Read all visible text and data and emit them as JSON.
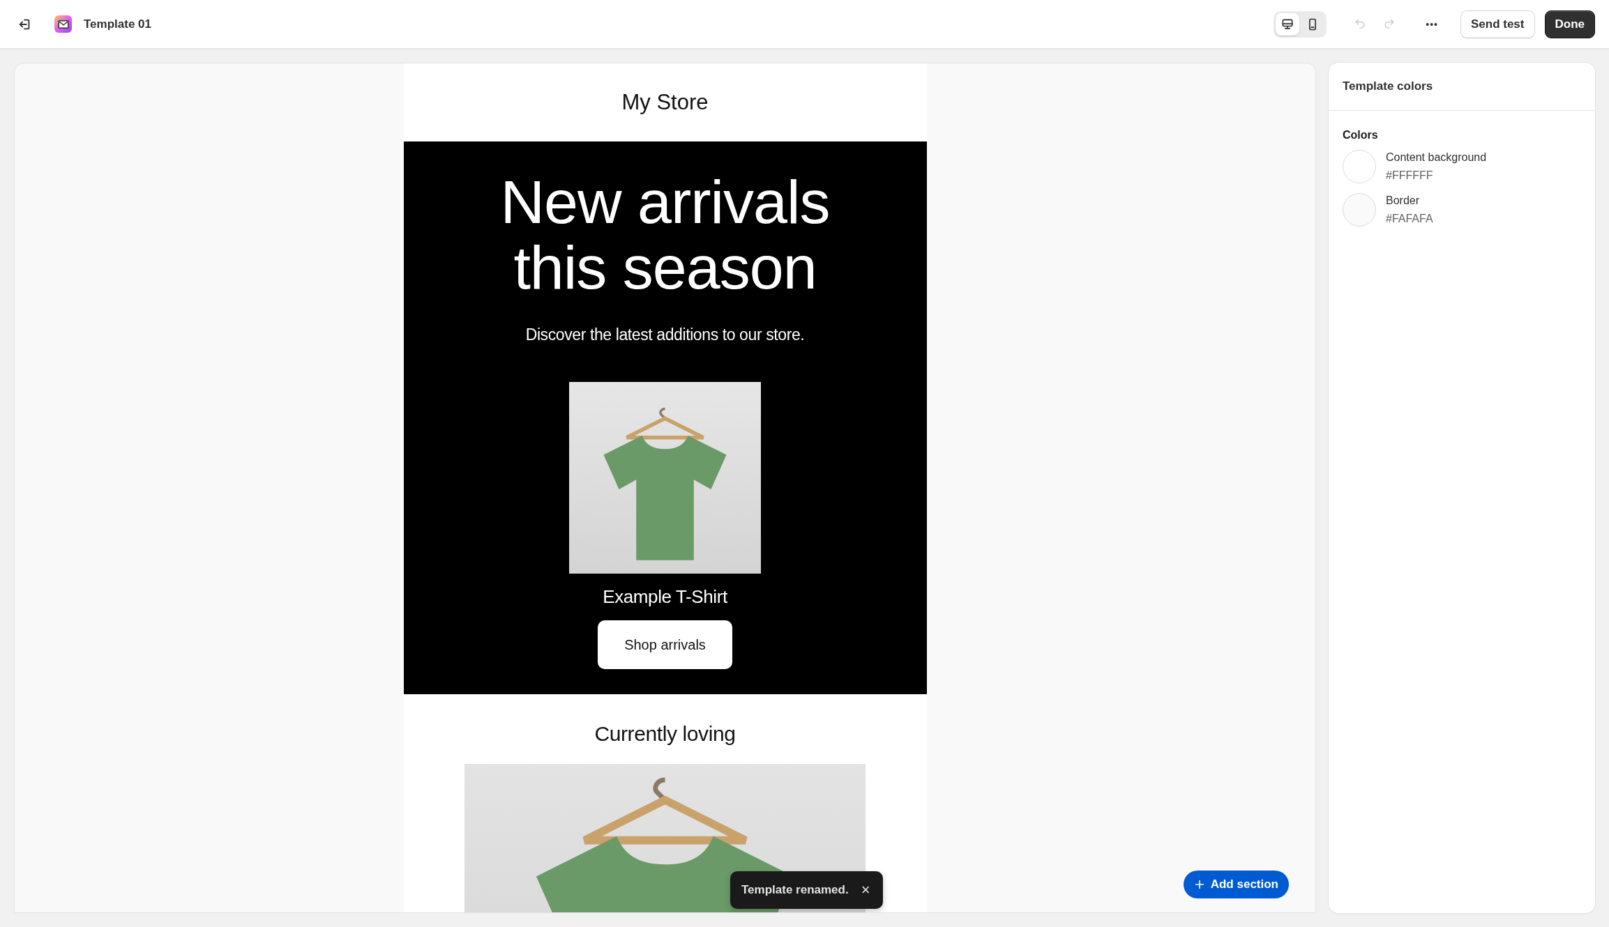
{
  "topbar": {
    "title": "Template 01",
    "view_modes": [
      {
        "kind": "desktop",
        "selected": true
      },
      {
        "kind": "mobile",
        "selected": false
      }
    ],
    "undo": {
      "disabled": true
    },
    "redo": {
      "disabled": true
    },
    "more": "•••",
    "send_test": "Send test",
    "done": "Done"
  },
  "email": {
    "store_name": "My Store",
    "hero": {
      "headline": "New arrivals this season",
      "subtitle": "Discover the latest additions to our store.",
      "product_name": "Example T-Shirt",
      "button": "Shop arrivals"
    },
    "section_title": "Currently loving"
  },
  "toast": {
    "message": "Template renamed.",
    "close": "×"
  },
  "add_section": "Add section",
  "panel": {
    "title": "Template colors",
    "group": "Colors",
    "colors": [
      {
        "name": "Content background",
        "value": "#FFFFFF",
        "color": "#ffffff"
      },
      {
        "name": "Border",
        "value": "#FAFAFA",
        "color": "#fafafa"
      }
    ]
  }
}
